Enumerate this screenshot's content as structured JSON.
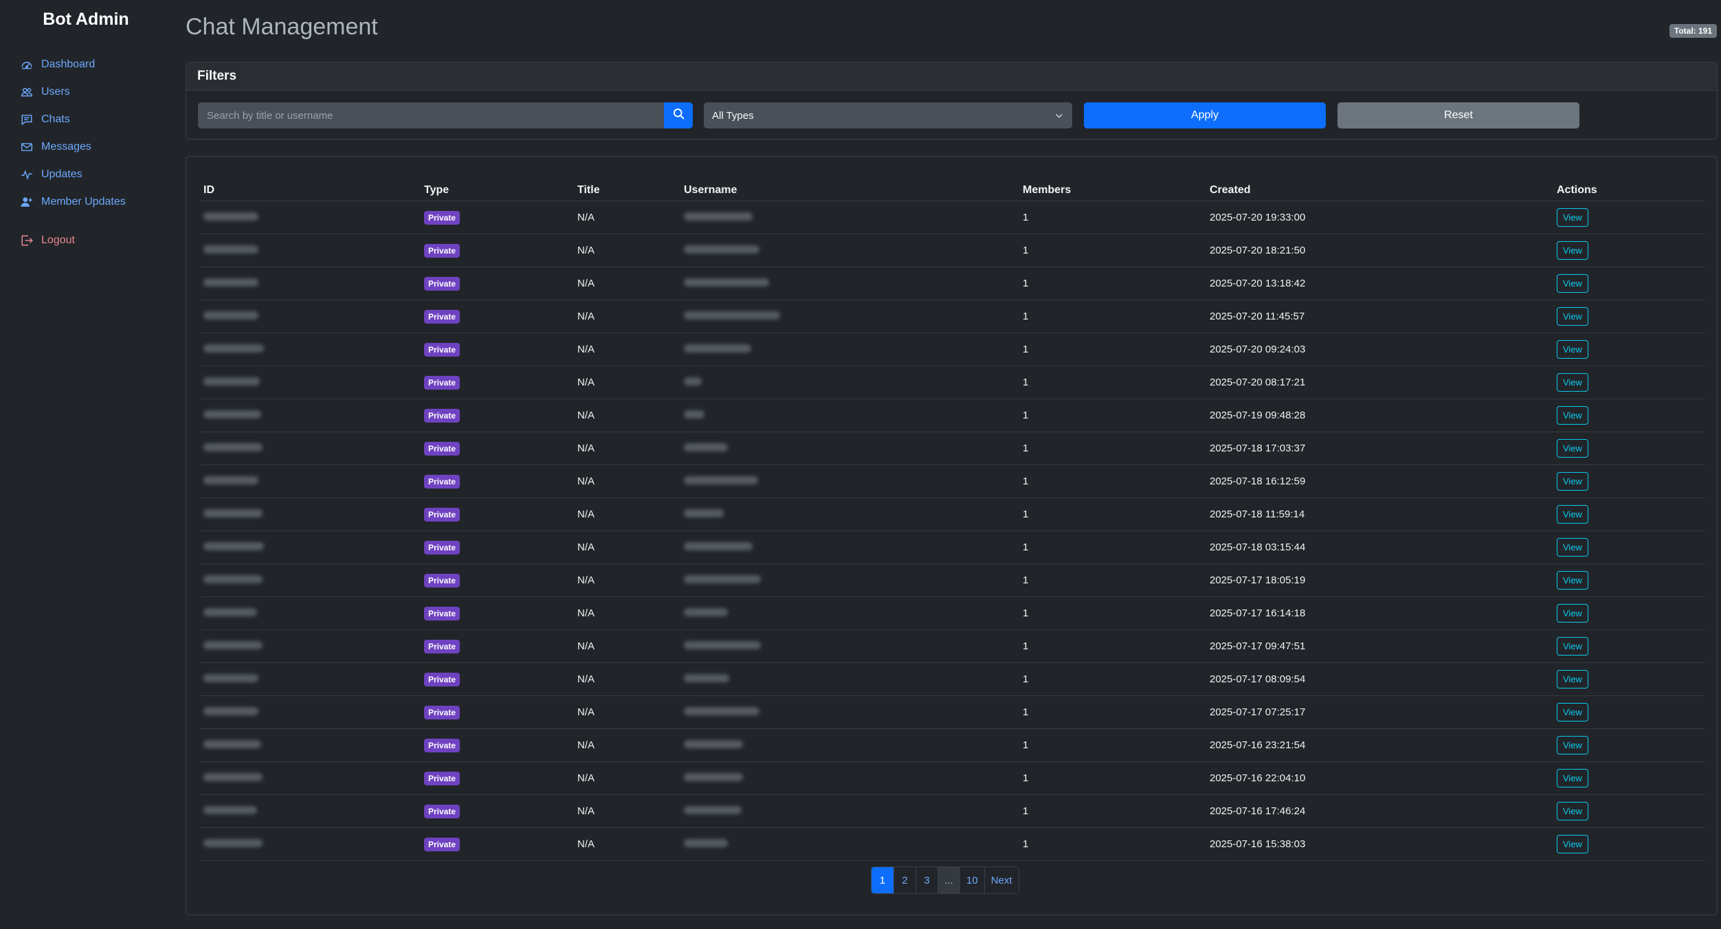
{
  "app": {
    "brand": "Bot Admin"
  },
  "sidebar": {
    "items": [
      {
        "label": "Dashboard",
        "icon": "speedometer-icon"
      },
      {
        "label": "Users",
        "icon": "people-icon"
      },
      {
        "label": "Chats",
        "icon": "chat-icon"
      },
      {
        "label": "Messages",
        "icon": "envelope-icon"
      },
      {
        "label": "Updates",
        "icon": "activity-icon"
      },
      {
        "label": "Member Updates",
        "icon": "person-plus-icon"
      }
    ],
    "logout": {
      "label": "Logout",
      "icon": "logout-icon"
    }
  },
  "page": {
    "title": "Chat Management",
    "total_badge": "Total: 191"
  },
  "filters": {
    "header": "Filters",
    "search_placeholder": "Search by title or username",
    "search_value": "",
    "type_select": "All Types",
    "apply_label": "Apply",
    "reset_label": "Reset"
  },
  "table": {
    "columns": [
      "ID",
      "Type",
      "Title",
      "Username",
      "Members",
      "Created",
      "Actions"
    ],
    "rows": [
      {
        "type": "Private",
        "title": "N/A",
        "members": "1",
        "created": "2025-07-20 19:33:00",
        "action": "View"
      },
      {
        "type": "Private",
        "title": "N/A",
        "members": "1",
        "created": "2025-07-20 18:21:50",
        "action": "View"
      },
      {
        "type": "Private",
        "title": "N/A",
        "members": "1",
        "created": "2025-07-20 13:18:42",
        "action": "View"
      },
      {
        "type": "Private",
        "title": "N/A",
        "members": "1",
        "created": "2025-07-20 11:45:57",
        "action": "View"
      },
      {
        "type": "Private",
        "title": "N/A",
        "members": "1",
        "created": "2025-07-20 09:24:03",
        "action": "View"
      },
      {
        "type": "Private",
        "title": "N/A",
        "members": "1",
        "created": "2025-07-20 08:17:21",
        "action": "View"
      },
      {
        "type": "Private",
        "title": "N/A",
        "members": "1",
        "created": "2025-07-19 09:48:28",
        "action": "View"
      },
      {
        "type": "Private",
        "title": "N/A",
        "members": "1",
        "created": "2025-07-18 17:03:37",
        "action": "View"
      },
      {
        "type": "Private",
        "title": "N/A",
        "members": "1",
        "created": "2025-07-18 16:12:59",
        "action": "View"
      },
      {
        "type": "Private",
        "title": "N/A",
        "members": "1",
        "created": "2025-07-18 11:59:14",
        "action": "View"
      },
      {
        "type": "Private",
        "title": "N/A",
        "members": "1",
        "created": "2025-07-18 03:15:44",
        "action": "View"
      },
      {
        "type": "Private",
        "title": "N/A",
        "members": "1",
        "created": "2025-07-17 18:05:19",
        "action": "View"
      },
      {
        "type": "Private",
        "title": "N/A",
        "members": "1",
        "created": "2025-07-17 16:14:18",
        "action": "View"
      },
      {
        "type": "Private",
        "title": "N/A",
        "members": "1",
        "created": "2025-07-17 09:47:51",
        "action": "View"
      },
      {
        "type": "Private",
        "title": "N/A",
        "members": "1",
        "created": "2025-07-17 08:09:54",
        "action": "View"
      },
      {
        "type": "Private",
        "title": "N/A",
        "members": "1",
        "created": "2025-07-17 07:25:17",
        "action": "View"
      },
      {
        "type": "Private",
        "title": "N/A",
        "members": "1",
        "created": "2025-07-16 23:21:54",
        "action": "View"
      },
      {
        "type": "Private",
        "title": "N/A",
        "members": "1",
        "created": "2025-07-16 22:04:10",
        "action": "View"
      },
      {
        "type": "Private",
        "title": "N/A",
        "members": "1",
        "created": "2025-07-16 17:46:24",
        "action": "View"
      },
      {
        "type": "Private",
        "title": "N/A",
        "members": "1",
        "created": "2025-07-16 15:38:03",
        "action": "View"
      }
    ]
  },
  "pagination": {
    "pages": [
      {
        "label": "1",
        "active": true
      },
      {
        "label": "2",
        "active": false
      },
      {
        "label": "3",
        "active": false
      },
      {
        "label": "...",
        "active": false,
        "ellipsis": true
      },
      {
        "label": "10",
        "active": false
      },
      {
        "label": "Next",
        "active": false
      }
    ]
  }
}
